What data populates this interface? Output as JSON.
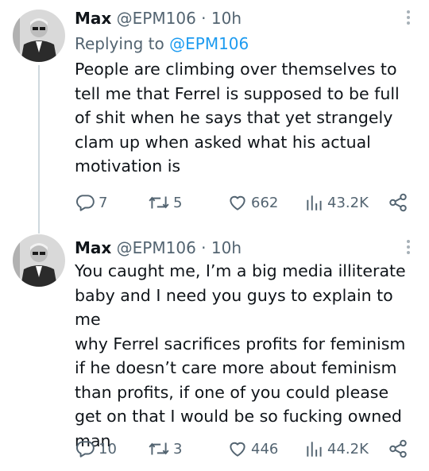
{
  "tweets": [
    {
      "name": "Max",
      "handle": "@EPM106",
      "separator": "·",
      "time": "10h",
      "replying_prefix": "Replying to",
      "replying_to": "@EPM106",
      "text": "People are climbing over themselves to\ntell me that Ferrel is supposed to be full\nof shit when he says that yet strangely\nclam up when asked what his actual\nmotivation is",
      "replies": "7",
      "retweets": "5",
      "likes": "662",
      "views": "43.2K"
    },
    {
      "name": "Max",
      "handle": "@EPM106",
      "separator": "·",
      "time": "10h",
      "text": "You caught me, I’m a big media illiterate\nbaby and I need you guys to explain to me\nwhy Ferrel sacrifices profits for feminism\nif he doesn’t care more about feminism\nthan profits, if one of you could please\nget on that I would be so fucking owned\nman",
      "replies": "10",
      "retweets": "3",
      "likes": "446",
      "views": "44.2K"
    }
  ],
  "icons": {
    "reply": "reply-icon",
    "retweet": "retweet-icon",
    "like": "heart-icon",
    "views": "views-icon",
    "share": "share-icon",
    "more": "more-icon"
  },
  "colors": {
    "accent": "#1d9bf0",
    "muted": "#536471",
    "text": "#0f1419",
    "thread_line": "#cfd9de"
  }
}
